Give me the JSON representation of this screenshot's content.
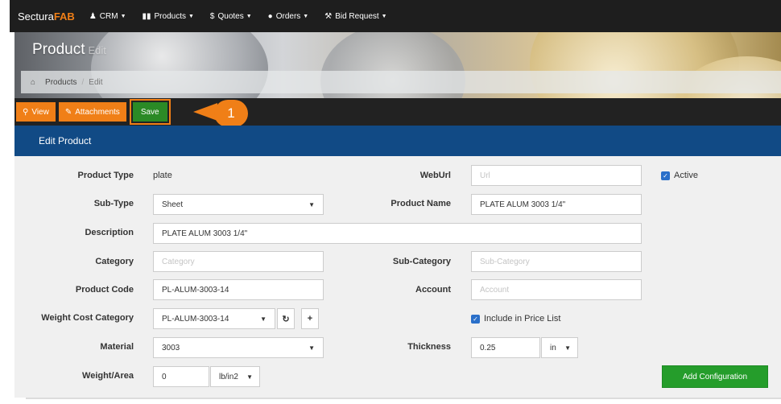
{
  "navbar": {
    "brand_main": "Sectura",
    "brand_accent": "FAB",
    "items": [
      {
        "label": "CRM",
        "icon": "user-icon"
      },
      {
        "label": "Products",
        "icon": "barcode-icon"
      },
      {
        "label": "Quotes",
        "icon": "dollar-icon"
      },
      {
        "label": "Orders",
        "icon": "bell-icon"
      },
      {
        "label": "Bid Request",
        "icon": "gavel-icon"
      }
    ]
  },
  "header": {
    "title": "Product",
    "subtitle": "Edit",
    "breadcrumb": [
      "Products",
      "Edit"
    ]
  },
  "toolbar": {
    "view_label": "View",
    "attachments_label": "Attachments",
    "save_label": "Save"
  },
  "callout": {
    "number": "1"
  },
  "section": {
    "title": "Edit Product"
  },
  "form": {
    "product_type_label": "Product Type",
    "product_type_value": "plate",
    "weburl_label": "WebUrl",
    "weburl_placeholder": "Url",
    "active_label": "Active",
    "subtype_label": "Sub-Type",
    "subtype_value": "Sheet",
    "product_name_label": "Product Name",
    "product_name_value": "PLATE ALUM 3003 1/4\"",
    "description_label": "Description",
    "description_value": "PLATE ALUM 3003 1/4\"",
    "category_label": "Category",
    "category_placeholder": "Category",
    "subcategory_label": "Sub-Category",
    "subcategory_placeholder": "Sub-Category",
    "product_code_label": "Product Code",
    "product_code_value": "PL-ALUM-3003-14",
    "account_label": "Account",
    "account_placeholder": "Account",
    "weight_cost_label": "Weight Cost Category",
    "weight_cost_value": "PL-ALUM-3003-14",
    "include_price_label": "Include in Price List",
    "material_label": "Material",
    "material_value": "3003",
    "thickness_label": "Thickness",
    "thickness_value": "0.25",
    "thickness_unit": "in",
    "weight_area_label": "Weight/Area",
    "weight_area_value": "0",
    "weight_area_unit": "lb/in2",
    "add_config_label": "Add Configuration"
  },
  "colors": {
    "accent": "#f07f17",
    "navbar": "#1e1e1e",
    "section_header": "#114a85",
    "save": "#2b8a26",
    "checkbox": "#2a6fc9"
  }
}
